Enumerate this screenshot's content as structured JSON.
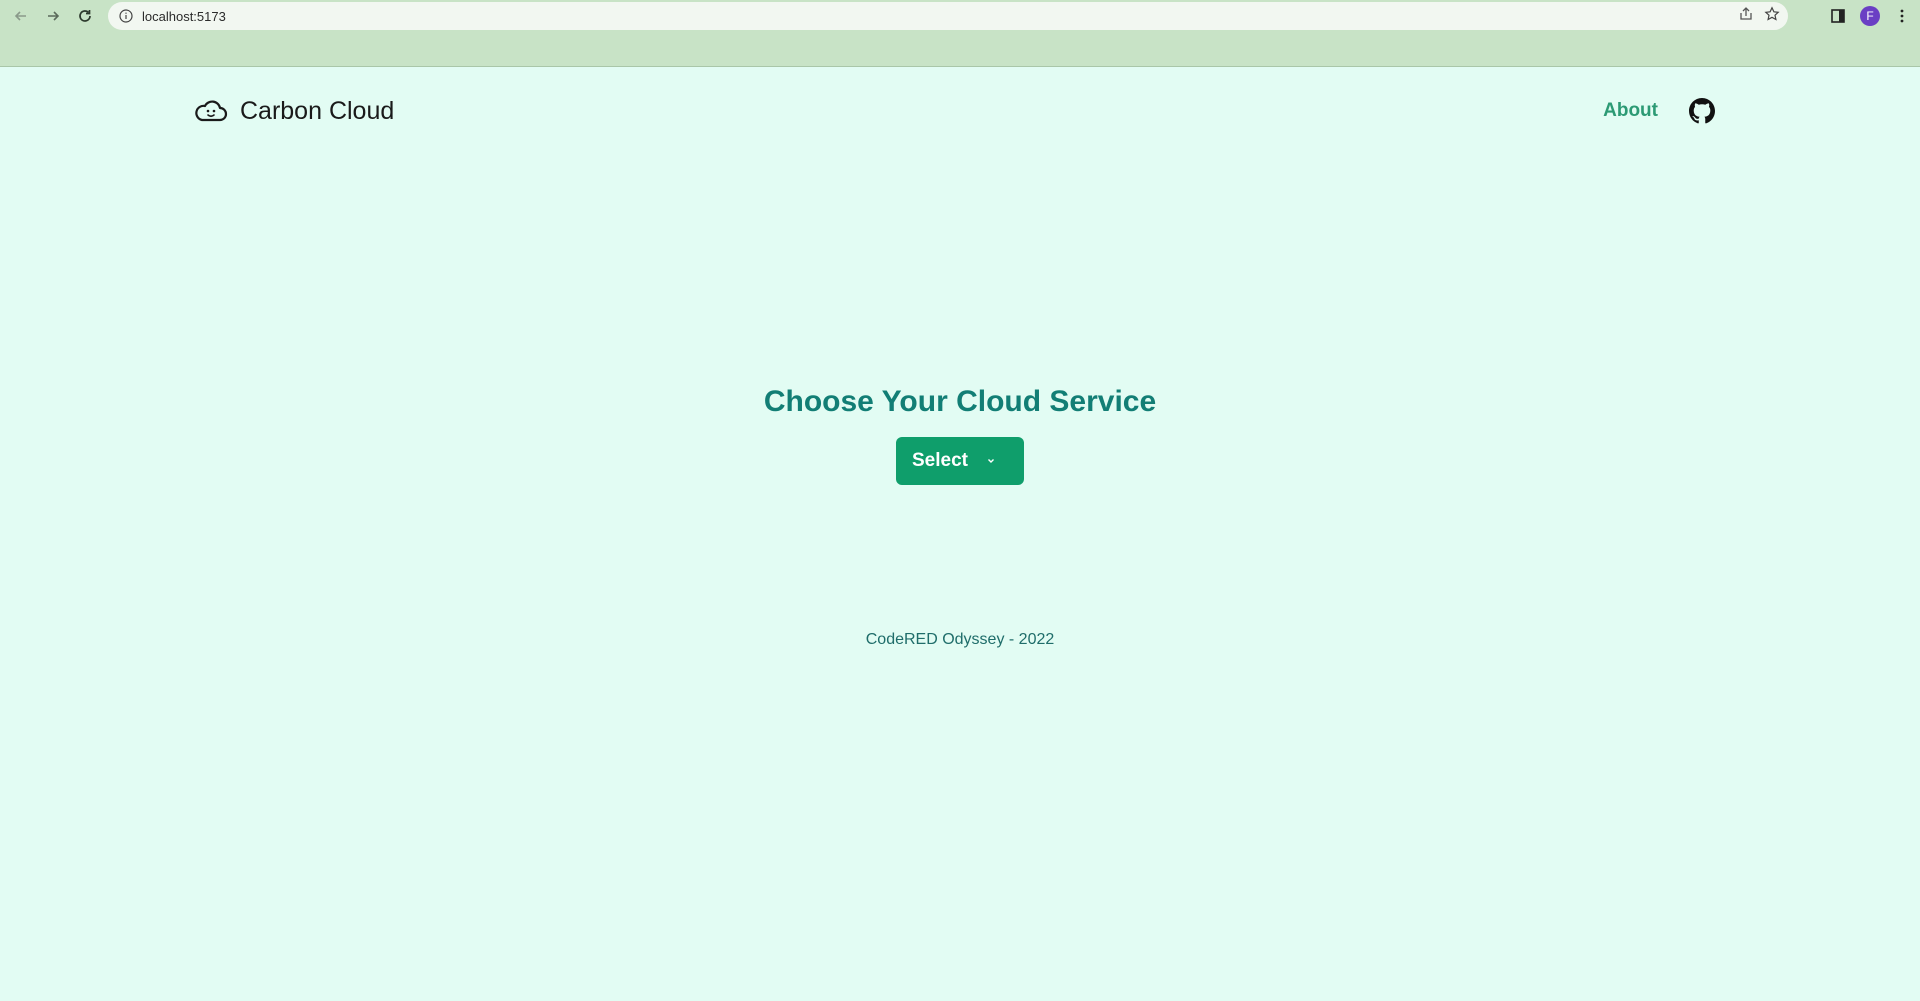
{
  "browser": {
    "url": "localhost:5173",
    "avatar_letter": "F",
    "avatar_color": "#6a3fc4"
  },
  "header": {
    "brand_name": "Carbon Cloud",
    "brand_icon": "cloud-smile-icon",
    "about_label": "About",
    "github_icon": "github-icon"
  },
  "main": {
    "title": "Choose Your Cloud Service",
    "select_label": "Select"
  },
  "footer": {
    "text": "CodeRED Odyssey - 2022"
  },
  "colors": {
    "page_bg": "#e2fcf3",
    "accent": "#0f9e6b",
    "title": "#127e75",
    "link": "#2c9a74"
  }
}
